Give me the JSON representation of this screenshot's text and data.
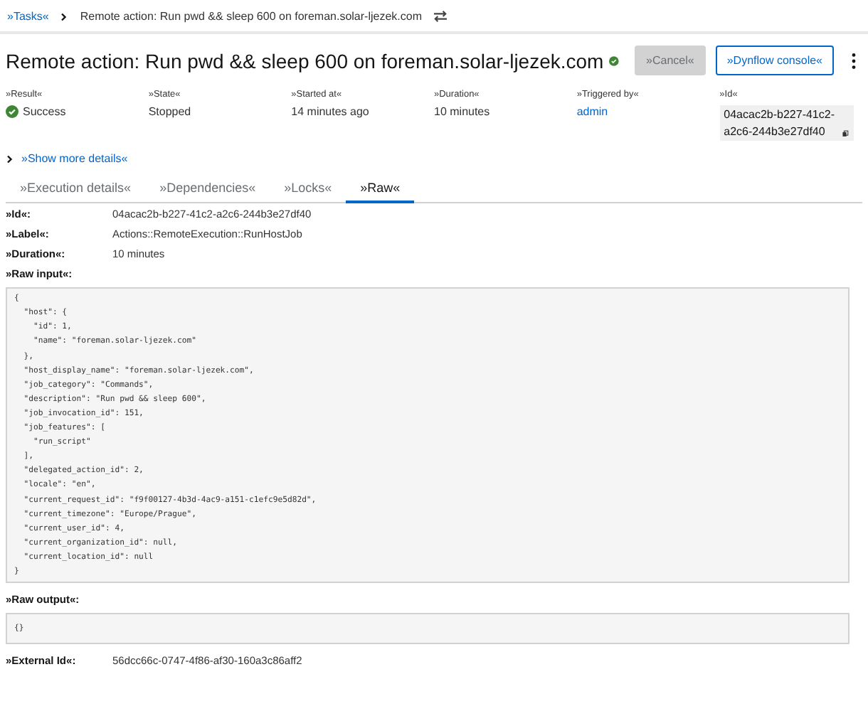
{
  "breadcrumb": {
    "parent": "»Tasks«",
    "current": "Remote action: Run pwd && sleep 600 on foreman.solar-ljezek.com"
  },
  "title": "Remote action: Run pwd && sleep 600 on foreman.solar-ljezek.com",
  "actions": [
    {
      "label": "»Cancel«",
      "disabled": true
    },
    {
      "label": "»Dynflow console«",
      "disabled": false
    }
  ],
  "summary": [
    {
      "label": "»Result«",
      "value": "Success",
      "kind": "status"
    },
    {
      "label": "»State«",
      "value": "Stopped",
      "kind": "text"
    },
    {
      "label": "»Started at«",
      "value": "14 minutes ago",
      "kind": "text"
    },
    {
      "label": "»Duration«",
      "value": "10 minutes",
      "kind": "text"
    },
    {
      "label": "»Triggered by«",
      "value": "admin",
      "kind": "link"
    },
    {
      "label": "»Id«",
      "value": "04acac2b-b227-41c2-a2c6-244b3e27df40",
      "kind": "copy"
    }
  ],
  "show_more": {
    "label": "»Show more details«",
    "expanded": false
  },
  "tabs": [
    {
      "label": "»Execution details«",
      "selected": false
    },
    {
      "label": "»Dependencies«",
      "selected": false
    },
    {
      "label": "»Locks«",
      "selected": false
    },
    {
      "label": "»Raw«",
      "selected": true
    }
  ],
  "raw": {
    "fields": [
      {
        "label": "»Id«:",
        "value": "04acac2b-b227-41c2-a2c6-244b3e27df40"
      },
      {
        "label": "»Label«:",
        "value": "Actions::RemoteExecution::RunHostJob"
      },
      {
        "label": "»Duration«:",
        "value": "10 minutes"
      }
    ],
    "input_label": "»Raw input«:",
    "input": "{\n  \"host\": {\n    \"id\": 1,\n    \"name\": \"foreman.solar-ljezek.com\"\n  },\n  \"host_display_name\": \"foreman.solar-ljezek.com\",\n  \"job_category\": \"Commands\",\n  \"description\": \"Run pwd && sleep 600\",\n  \"job_invocation_id\": 151,\n  \"job_features\": [\n    \"run_script\"\n  ],\n  \"delegated_action_id\": 2,\n  \"locale\": \"en\",\n  \"current_request_id\": \"f9f00127-4b3d-4ac9-a151-c1efc9e5d82d\",\n  \"current_timezone\": \"Europe/Prague\",\n  \"current_user_id\": 4,\n  \"current_organization_id\": null,\n  \"current_location_id\": null\n}",
    "output_label": "»Raw output«:",
    "output": "{}",
    "external": {
      "label": "»External Id«:",
      "value": "56dcc66c-0747-4f86-af30-160a3c86aff2"
    }
  }
}
